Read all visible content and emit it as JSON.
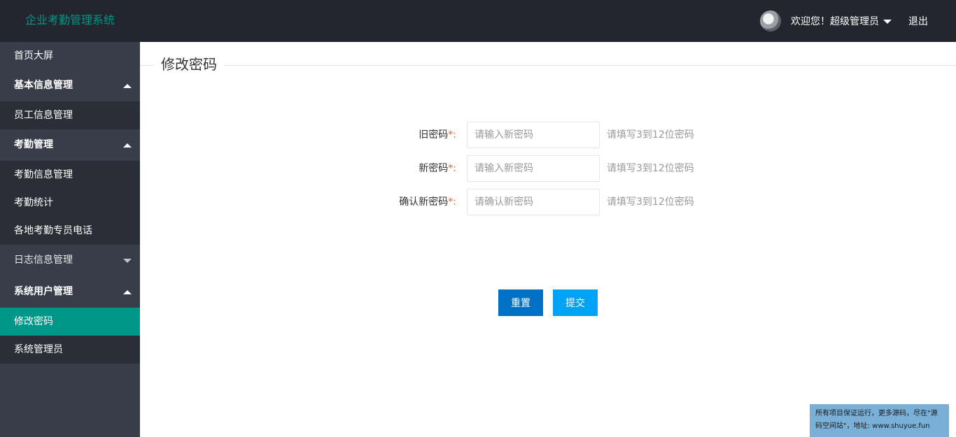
{
  "header": {
    "logo": "企业考勤管理系统",
    "welcome": "欢迎您！超级管理员",
    "logout": "退出"
  },
  "sidebar": {
    "home": "首页大屏",
    "groups": [
      {
        "label": "基本信息管理",
        "items": [
          "员工信息管理"
        ]
      },
      {
        "label": "考勤管理",
        "items": [
          "考勤信息管理",
          "考勤统计",
          "各地考勤专员电话"
        ]
      },
      {
        "label": "日志信息管理",
        "items": []
      },
      {
        "label": "系统用户管理",
        "items": [
          "修改密码",
          "系统管理员"
        ]
      }
    ]
  },
  "main": {
    "title": "修改密码",
    "form": {
      "old": {
        "label": "旧密码",
        "required": "*",
        "colon": ":",
        "placeholder": "请输入新密码",
        "tip": "请填写3到12位密码"
      },
      "new": {
        "label": "新密码",
        "required": "*",
        "colon": ":",
        "placeholder": "请输入新密码",
        "tip": "请填写3到12位密码"
      },
      "confirm": {
        "label": "确认新密码",
        "required": "*",
        "colon": ":",
        "placeholder": "请确认新密码",
        "tip": "请填写3到12位密码"
      }
    },
    "buttons": {
      "reset": "重置",
      "submit": "提交"
    }
  },
  "notice": "所有项目保证运行，更多源码，尽在\"源码空间站\"，地址: www.shuyue.fun",
  "colors": {
    "header_bg": "#23262e",
    "sidebar_bg": "#393d49",
    "sidebar_sub_bg": "#2b2e37",
    "accent": "#009688",
    "reset_button": "#0071c5",
    "submit_button": "#00a2f5",
    "required": "#ff5722"
  }
}
